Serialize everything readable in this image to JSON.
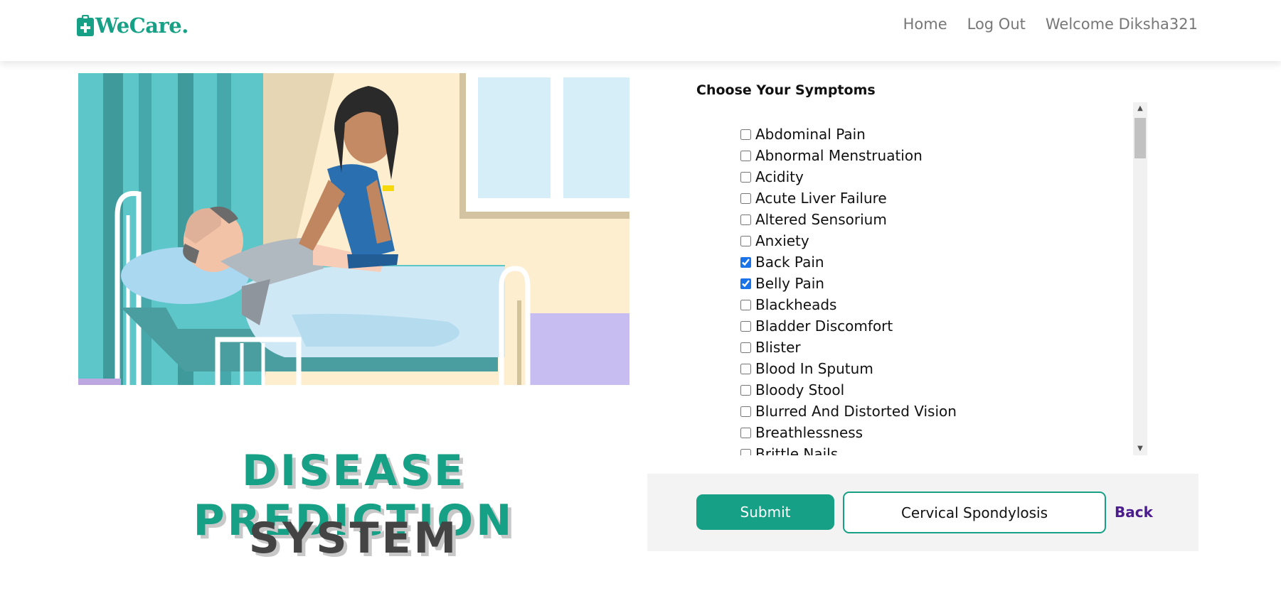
{
  "brand": {
    "name": "WeCare.",
    "icon": "medical-clipboard-icon",
    "color": "#16a085"
  },
  "nav": {
    "home": "Home",
    "logout": "Log Out",
    "welcome": "Welcome Diksha321"
  },
  "hero": {
    "title_line1": "DISEASE PREDICTION",
    "title_line2": "SYSTEM",
    "illustration": "nurse-patient-hospital-bed-illustration"
  },
  "symptoms": {
    "heading": "Choose Your Symptoms",
    "items": [
      {
        "label": "Abdominal Pain",
        "checked": false
      },
      {
        "label": "Abnormal Menstruation",
        "checked": false
      },
      {
        "label": "Acidity",
        "checked": false
      },
      {
        "label": "Acute Liver Failure",
        "checked": false
      },
      {
        "label": "Altered Sensorium",
        "checked": false
      },
      {
        "label": "Anxiety",
        "checked": false
      },
      {
        "label": "Back Pain",
        "checked": true
      },
      {
        "label": "Belly Pain",
        "checked": true
      },
      {
        "label": "Blackheads",
        "checked": false
      },
      {
        "label": "Bladder Discomfort",
        "checked": false
      },
      {
        "label": "Blister",
        "checked": false
      },
      {
        "label": "Blood In Sputum",
        "checked": false
      },
      {
        "label": "Bloody Stool",
        "checked": false
      },
      {
        "label": "Blurred And Distorted Vision",
        "checked": false
      },
      {
        "label": "Breathlessness",
        "checked": false
      },
      {
        "label": "Brittle Nails",
        "checked": false
      }
    ]
  },
  "actions": {
    "submit_label": "Submit",
    "result": "Cervical Spondylosis",
    "back_label": "Back"
  },
  "colors": {
    "accent": "#16a085",
    "link": "#4b1c8f",
    "title_dark": "#444444"
  }
}
